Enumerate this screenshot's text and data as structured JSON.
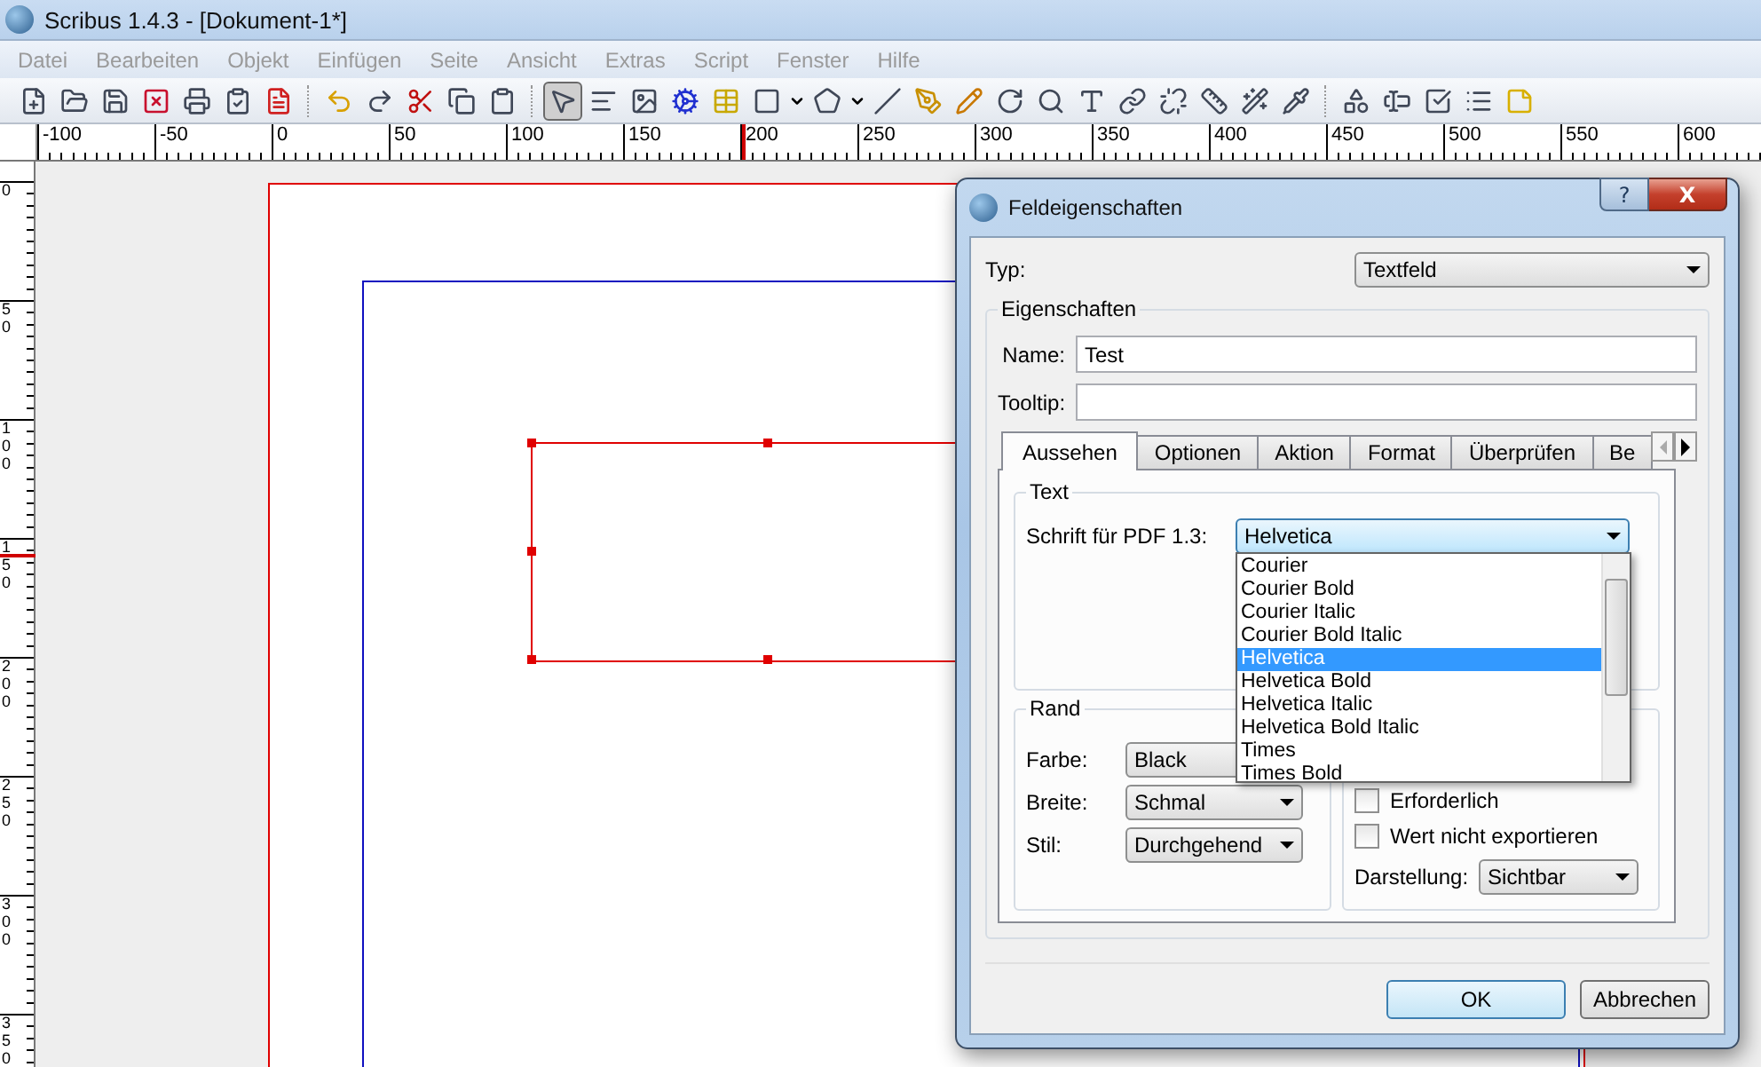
{
  "window": {
    "title": "Scribus 1.4.3 - [Dokument-1*]"
  },
  "menu": [
    "Datei",
    "Bearbeiten",
    "Objekt",
    "Einfügen",
    "Seite",
    "Ansicht",
    "Extras",
    "Script",
    "Fenster",
    "Hilfe"
  ],
  "tools": [
    {
      "selected": false
    },
    {
      "selected": false
    },
    {
      "selected": false
    },
    {
      "selected": false
    },
    {
      "selected": false
    },
    {
      "selected": false
    },
    {
      "selected": false
    },
    {
      "selected": false
    },
    {
      "selected": false
    },
    {
      "selected": false
    },
    {
      "selected": false
    },
    {
      "selected": false
    },
    {
      "selected": true
    },
    {
      "selected": false
    },
    {
      "selected": false
    },
    {
      "selected": false
    },
    {
      "selected": false
    },
    {
      "selected": false
    },
    {
      "selected": false
    },
    {
      "selected": false
    },
    {
      "selected": false
    },
    {
      "selected": false
    },
    {
      "selected": false
    },
    {
      "selected": false
    },
    {
      "selected": false
    },
    {
      "selected": false
    },
    {
      "selected": false
    },
    {
      "selected": false
    },
    {
      "selected": false
    },
    {
      "selected": false
    },
    {
      "selected": false
    },
    {
      "selected": false
    },
    {
      "selected": false
    },
    {
      "selected": false
    },
    {
      "selected": false
    }
  ],
  "ruler": {
    "horizontal_labels": [
      "-100",
      "-50",
      "0",
      "50",
      "100",
      "150",
      "200",
      "250",
      "300",
      "350",
      "400",
      "450",
      "500",
      "550",
      "600"
    ],
    "vertical_labels": [
      "0",
      "50",
      "100",
      "150",
      "200",
      "250",
      "300",
      "350"
    ]
  },
  "dialog": {
    "title": "Feldeigenschaften",
    "help": "?",
    "close": "X",
    "type": {
      "label": "Typ:",
      "value": "Textfeld"
    },
    "properties": {
      "title": "Eigenschaften",
      "name": {
        "label": "Name:",
        "value": "Test"
      },
      "tooltip": {
        "label": "Tooltip:"
      }
    },
    "tabs": [
      {
        "label": "Aussehen",
        "selected": true
      },
      {
        "label": "Optionen",
        "selected": false
      },
      {
        "label": "Aktion",
        "selected": false
      },
      {
        "label": "Format",
        "selected": false
      },
      {
        "label": "Überprüfen",
        "selected": false
      },
      {
        "label": "Be",
        "selected": false
      }
    ],
    "text_group": {
      "title": "Text",
      "font_label": "Schrift für PDF 1.3:",
      "font_value": "Helvetica",
      "font_options": [
        {
          "label": "Courier",
          "selected": false
        },
        {
          "label": "Courier Bold",
          "selected": false
        },
        {
          "label": "Courier Italic",
          "selected": false
        },
        {
          "label": "Courier Bold Italic",
          "selected": false
        },
        {
          "label": "Helvetica",
          "selected": true
        },
        {
          "label": "Helvetica Bold",
          "selected": false
        },
        {
          "label": "Helvetica Italic",
          "selected": false
        },
        {
          "label": "Helvetica Bold Italic",
          "selected": false
        },
        {
          "label": "Times",
          "selected": false
        },
        {
          "label": "Times Bold",
          "selected": false
        }
      ]
    },
    "border_group": {
      "title": "Rand",
      "rows": [
        {
          "label": "Farbe:",
          "value": "Black"
        },
        {
          "label": "Breite:",
          "value": "Schmal"
        },
        {
          "label": "Stil:",
          "value": "Durchgehend"
        }
      ]
    },
    "flags": [
      {
        "label": "Erforderlich",
        "checked": false
      },
      {
        "label": "Wert nicht exportieren",
        "checked": false
      }
    ],
    "display": {
      "label": "Darstellung:",
      "value": "Sichtbar"
    },
    "buttons": [
      {
        "label": "OK",
        "default": true
      },
      {
        "label": "Abbrechen",
        "default": false
      }
    ]
  }
}
